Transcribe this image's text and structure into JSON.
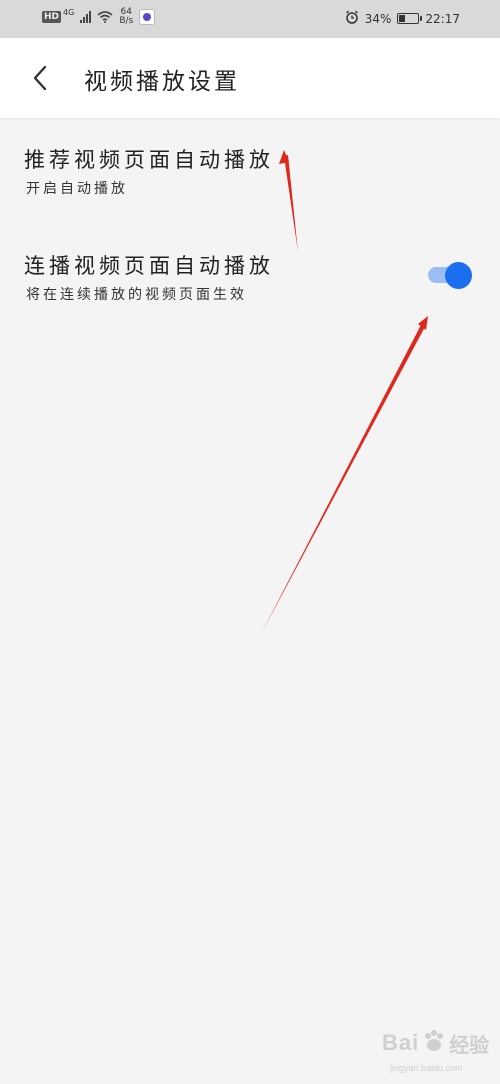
{
  "status_bar": {
    "hd": "HD",
    "network": "4G",
    "speed_value": "64",
    "speed_unit": "B/s",
    "battery_percent": "34%",
    "battery_level": 0.34,
    "time": "22:17"
  },
  "header": {
    "title": "视频播放设置",
    "back_icon": "chevron-left-icon"
  },
  "settings": [
    {
      "title": "推荐视频页面自动播放",
      "description": "开启自动播放"
    },
    {
      "title": "连播视频页面自动播放",
      "description": "将在连续播放的视频页面生效",
      "toggle_on": true
    }
  ],
  "watermark": {
    "brand": "Bai",
    "brand_suffix": "经验",
    "url": "jingyan.baidu.com"
  },
  "colors": {
    "toggle_on": "#1a6ff0",
    "toggle_track": "#9cbcf4",
    "annotation_arrow": "#e0271e",
    "background": "#f4f4f4"
  }
}
